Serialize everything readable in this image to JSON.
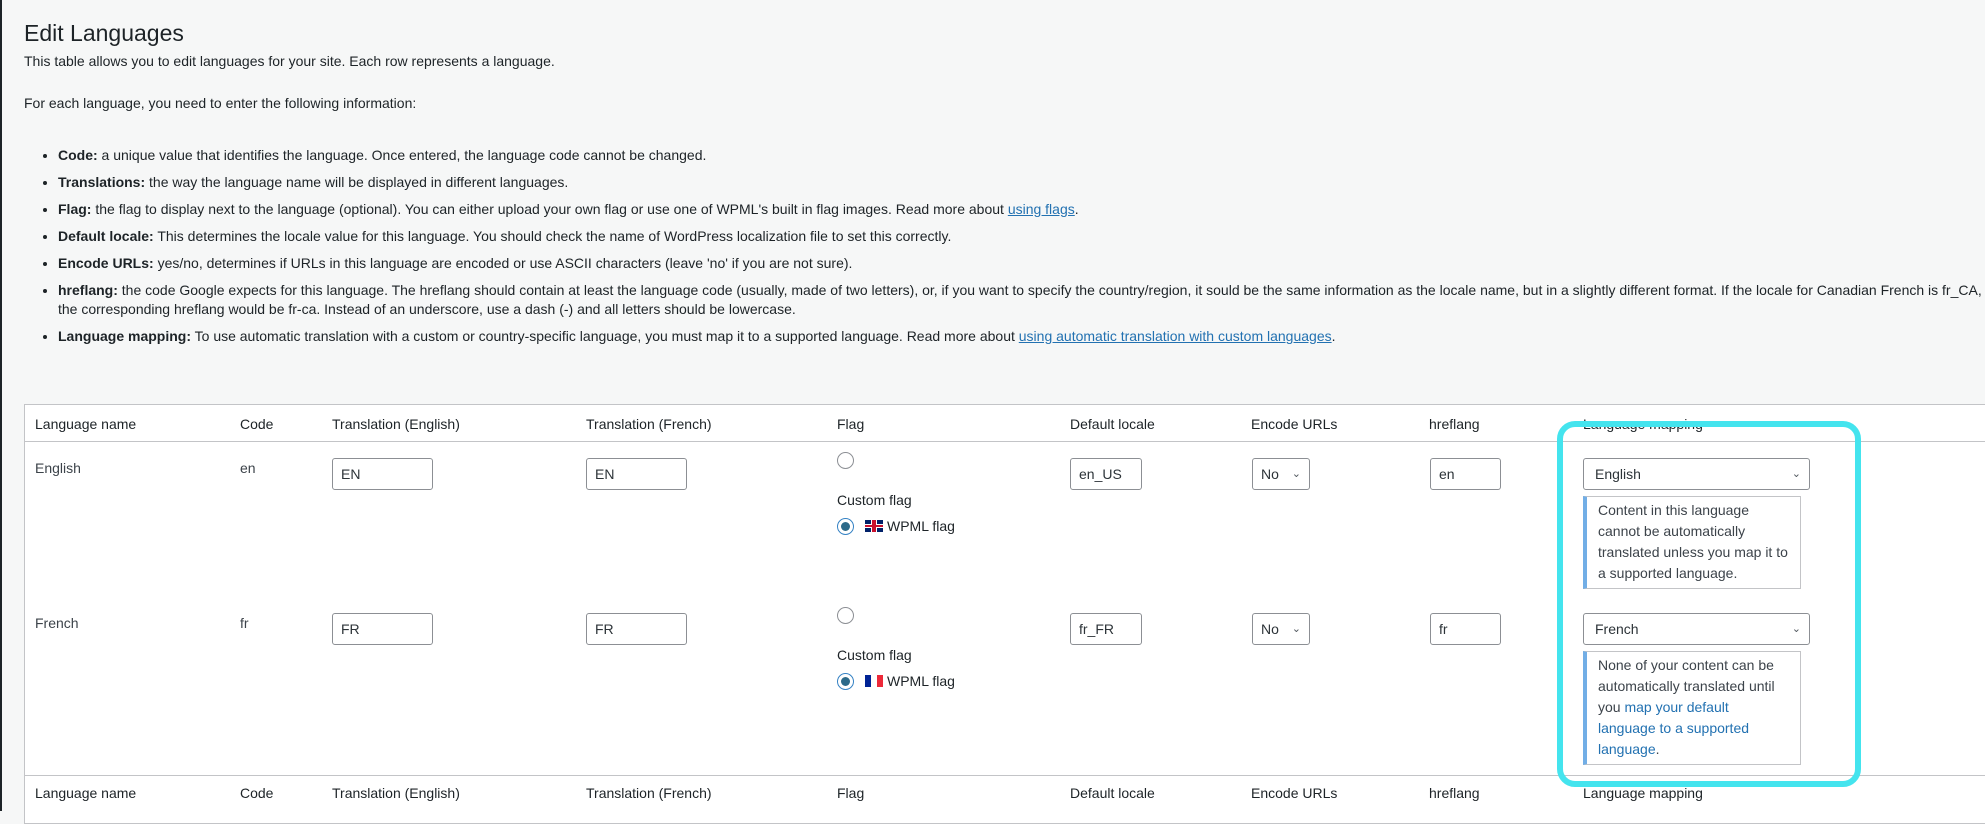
{
  "page": {
    "title": "Edit Languages",
    "intro": "This table allows you to edit languages for your site. Each row represents a language.",
    "intro2": "For each language, you need to enter the following information:"
  },
  "help_items": [
    {
      "term": "Code:",
      "text": " a unique value that identifies the language. Once entered, the language code cannot be changed."
    },
    {
      "term": "Translations:",
      "text": " the way the language name will be displayed in different languages."
    },
    {
      "term": "Flag:",
      "text": " the flag to display next to the language (optional). You can either upload your own flag or use one of WPML's built in flag images. Read more about ",
      "link": "using flags",
      "after": "."
    },
    {
      "term": "Default locale:",
      "text": " This determines the locale value for this language. You should check the name of WordPress localization file to set this correctly."
    },
    {
      "term": "Encode URLs:",
      "text": " yes/no, determines if URLs in this language are encoded or use ASCII characters (leave 'no' if you are not sure)."
    },
    {
      "term": "hreflang:",
      "text": " the code Google expects for this language. The hreflang should contain at least the language code (usually, made of two letters), or, if you want to specify the country/region, it sould be the same information as the locale name, but in a slightly different format. If the locale for Canadian French is fr_CA, the corresponding hreflang would be fr-ca. Instead of an underscore, use a dash (-) and all letters should be lowercase."
    },
    {
      "term": "Language mapping:",
      "text": " To use automatic translation with a custom or country-specific language, you must map it to a supported language. Read more about ",
      "link": "using automatic translation with custom languages",
      "after": "."
    }
  ],
  "table": {
    "headers": [
      "Language name",
      "Code",
      "Translation (English)",
      "Translation (French)",
      "Flag",
      "Default locale",
      "Encode URLs",
      "hreflang",
      "Language mapping"
    ],
    "custom_flag_label": "Custom flag",
    "wpml_flag_label": "WPML flag",
    "rows": [
      {
        "name": "English",
        "code": "en",
        "trans_en": "EN",
        "trans_fr": "EN",
        "flag": "uk-flag-icon",
        "locale": "en_US",
        "encode": "No",
        "hreflang": "en",
        "mapping": "English",
        "notice": "Content in this language cannot be automatically translated unless you map it to a supported language."
      },
      {
        "name": "French",
        "code": "fr",
        "trans_en": "FR",
        "trans_fr": "FR",
        "flag": "france-flag-icon",
        "locale": "fr_FR",
        "encode": "No",
        "hreflang": "fr",
        "mapping": "French",
        "notice_pre": "None of your content can be automatically translated until you ",
        "notice_link": "map your default language to a supported language",
        "notice_post": "."
      }
    ]
  },
  "colors": {
    "highlight": "#44e4ee",
    "link": "#2271b1",
    "notice_border": "#72aee6"
  }
}
